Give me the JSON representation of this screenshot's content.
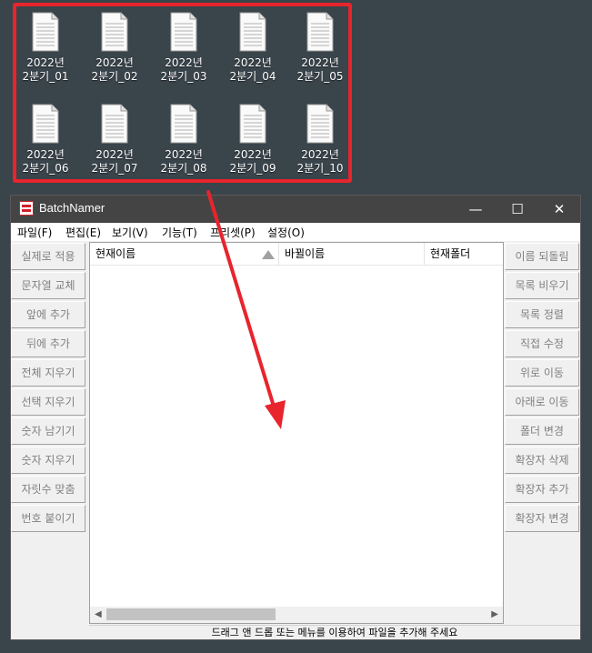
{
  "desktop": {
    "files": [
      {
        "line1": "2022년",
        "line2": "2분기_01"
      },
      {
        "line1": "2022년",
        "line2": "2분기_02"
      },
      {
        "line1": "2022년",
        "line2": "2분기_03"
      },
      {
        "line1": "2022년",
        "line2": "2분기_04"
      },
      {
        "line1": "2022년",
        "line2": "2분기_05"
      },
      {
        "line1": "2022년",
        "line2": "2분기_06"
      },
      {
        "line1": "2022년",
        "line2": "2분기_07"
      },
      {
        "line1": "2022년",
        "line2": "2분기_08"
      },
      {
        "line1": "2022년",
        "line2": "2분기_09"
      },
      {
        "line1": "2022년",
        "line2": "2분기_10"
      }
    ],
    "selection_color": "#e8242d",
    "arrow_color": "#e8242d"
  },
  "window": {
    "title": "BatchNamer",
    "controls": {
      "minimize": "—",
      "maximize": "☐",
      "close": "✕"
    }
  },
  "menu": [
    "파일(F)",
    "편집(E)",
    "보기(V)",
    "기능(T)",
    "프리셋(P)",
    "설정(O)"
  ],
  "left_buttons": [
    "실제로 적용",
    "문자열 교체",
    "앞에 추가",
    "뒤에 추가",
    "전체 지우기",
    "선택 지우기",
    "숫자 남기기",
    "숫자 지우기",
    "자릿수 맞춤",
    "번호 붙이기"
  ],
  "right_buttons": [
    "이름 되돌림",
    "목록 비우기",
    "목록 정렬",
    "직접 수정",
    "위로 이동",
    "아래로 이동",
    "폴더 변경",
    "확장자 삭제",
    "확장자 추가",
    "확장자 변경"
  ],
  "columns": [
    "현재이름",
    "바뀔이름",
    "현재폴더"
  ],
  "status": "드래그 앤 드롭 또는 메뉴를 이용하여 파일을 추가해 주세요"
}
